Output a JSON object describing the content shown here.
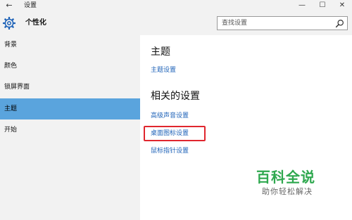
{
  "window": {
    "title": "设置",
    "back_icon": "back-arrow-icon",
    "minimize_glyph": "—",
    "maximize_glyph": "☐",
    "close_glyph": "✕"
  },
  "header": {
    "title": "个性化",
    "icon": "gear-icon"
  },
  "search": {
    "placeholder": "查找设置",
    "icon": "search-icon"
  },
  "sidebar": {
    "items": [
      {
        "label": "背景",
        "active": false
      },
      {
        "label": "颜色",
        "active": false
      },
      {
        "label": "锁屏界面",
        "active": false
      },
      {
        "label": "主题",
        "active": true
      },
      {
        "label": "开始",
        "active": false
      }
    ]
  },
  "main": {
    "theme_heading": "主题",
    "theme_settings_link": "主题设置",
    "related_heading": "相关的设置",
    "related_links": [
      "高级声音设置",
      "桌面图标设置",
      "鼠标指针设置"
    ]
  },
  "watermark": {
    "title": "百科全说",
    "subtitle": "助你轻松解决"
  },
  "colors": {
    "accent": "#5aa4dd",
    "link": "#1f63b8",
    "highlight": "#e0262e",
    "watermark": "#2fa84f"
  }
}
